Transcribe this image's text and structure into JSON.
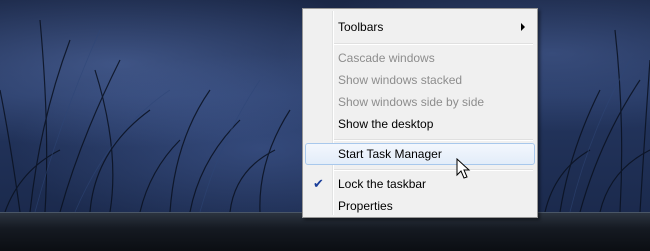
{
  "context_menu": {
    "items": [
      {
        "label": "Toolbars"
      },
      {
        "label": "Cascade windows"
      },
      {
        "label": "Show windows stacked"
      },
      {
        "label": "Show windows side by side"
      },
      {
        "label": "Show the desktop"
      },
      {
        "label": "Start Task Manager"
      },
      {
        "label": "Lock the taskbar"
      },
      {
        "label": "Properties"
      }
    ],
    "disabled_items": [
      "Cascade windows",
      "Show windows stacked",
      "Show windows side by side"
    ],
    "hovered_item": "Start Task Manager",
    "checked_items": [
      "Lock the taskbar"
    ]
  },
  "icons": {
    "submenu": "chevron-right-icon",
    "check": "check-icon",
    "cursor": "mouse-pointer-icon"
  },
  "colors": {
    "menu_background": "#f0f0f0",
    "hover_highlight": "#e3edf9",
    "hover_border": "#a8c8ec",
    "disabled_text": "#8d8d8d",
    "check_mark": "#1a3e9a",
    "taskbar": "#151a22"
  }
}
